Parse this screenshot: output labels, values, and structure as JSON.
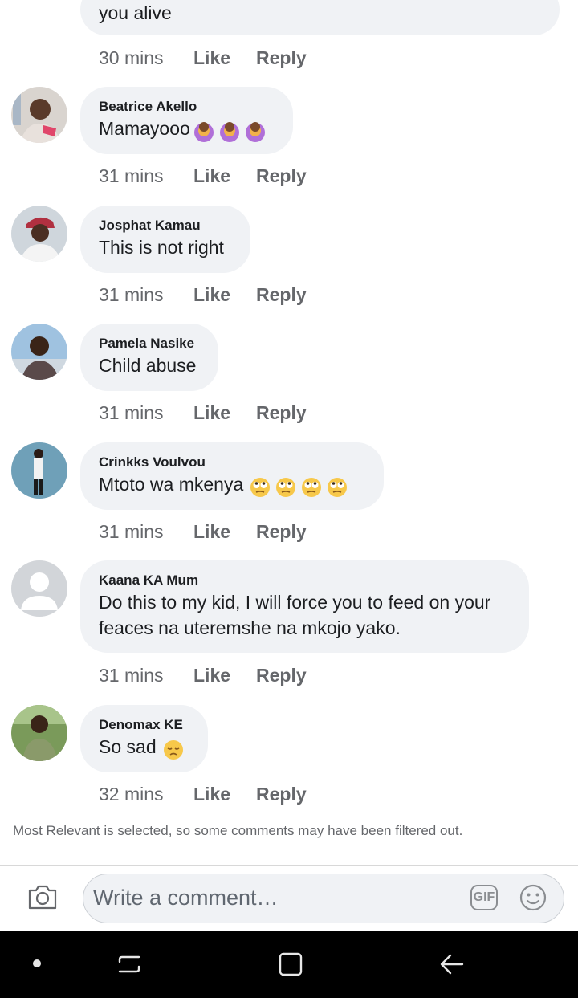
{
  "comments": [
    {
      "name": "",
      "text": "you alive",
      "time": "30 mins",
      "like": "Like",
      "reply": "Reply"
    },
    {
      "name": "Beatrice Akello",
      "text": "Mamayooo",
      "emojis": [
        "person-gesturing-emoji",
        "person-gesturing-emoji",
        "person-gesturing-emoji"
      ],
      "time": "31 mins",
      "like": "Like",
      "reply": "Reply"
    },
    {
      "name": "Josphat Kamau",
      "text": "This is not right",
      "time": "31 mins",
      "like": "Like",
      "reply": "Reply"
    },
    {
      "name": "Pamela Nasike",
      "text": "Child abuse",
      "time": "31 mins",
      "like": "Like",
      "reply": "Reply"
    },
    {
      "name": "Crinkks Voulvou",
      "text": "Mtoto wa mkenya",
      "emojis": [
        "rolling-eyes-emoji",
        "rolling-eyes-emoji",
        "rolling-eyes-emoji",
        "rolling-eyes-emoji"
      ],
      "time": "31 mins",
      "like": "Like",
      "reply": "Reply"
    },
    {
      "name": "Kaana KA Mum",
      "text_line1": "Do this to my kid, I will force you to feed on your",
      "text_line2": "feaces na uteremshe na mkojo yako.",
      "time": "31 mins",
      "like": "Like",
      "reply": "Reply"
    },
    {
      "name": "Denomax KE",
      "text": "So sad",
      "emojis": [
        "pensive-face-emoji"
      ],
      "time": "32 mins",
      "like": "Like",
      "reply": "Reply"
    }
  ],
  "filter_note": "Most Relevant is selected, so some comments may have been filtered out.",
  "composer": {
    "placeholder": "Write a comment…",
    "gif_label": "GIF",
    "icons": [
      "camera-icon",
      "gif-icon",
      "smiley-icon"
    ]
  },
  "navbar": {
    "icons": [
      "dot-icon",
      "recent-apps-icon",
      "home-icon",
      "back-icon"
    ]
  },
  "colors": {
    "bubble": "#f0f2f5",
    "meta": "#65676b",
    "navbar": "#000000"
  }
}
